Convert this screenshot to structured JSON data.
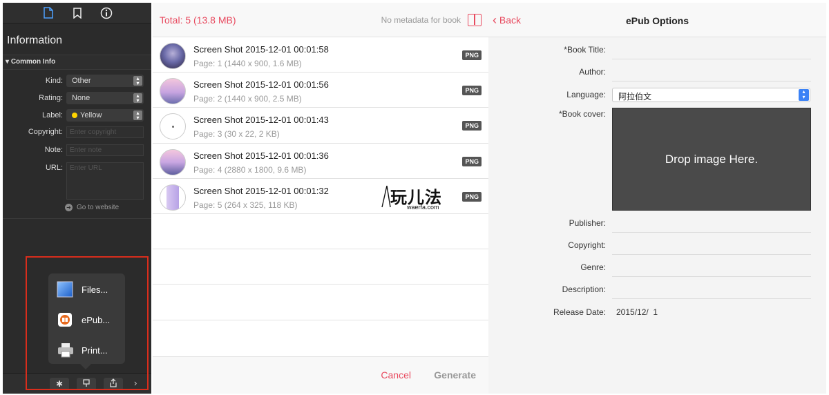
{
  "sidebar": {
    "title": "Information",
    "section": "Common Info",
    "fields": {
      "kind_label": "Kind:",
      "kind_value": "Other",
      "rating_label": "Rating:",
      "rating_value": "None",
      "label_label": "Label:",
      "label_value": "Yellow",
      "copyright_label": "Copyright:",
      "copyright_placeholder": "Enter copyright",
      "note_label": "Note:",
      "note_placeholder": "Enter note",
      "url_label": "URL:",
      "url_placeholder": "Enter URL"
    },
    "go_to_website": "Go to website",
    "popup": {
      "files": "Files...",
      "epub": "ePub...",
      "print": "Print..."
    }
  },
  "list": {
    "total": "Total: 5 (13.8 MB)",
    "no_metadata": "No metadata for book",
    "items": [
      {
        "name": "Screen Shot 2015-12-01 00:01:58",
        "sub": "Page: 1 (1440 x 900, 1.6 MB)",
        "badge": "PNG"
      },
      {
        "name": "Screen Shot 2015-12-01 00:01:56",
        "sub": "Page: 2 (1440 x 900, 2.5 MB)",
        "badge": "PNG"
      },
      {
        "name": "Screen Shot 2015-12-01 00:01:43",
        "sub": "Page: 3 (30 x 22, 2 KB)",
        "badge": "PNG"
      },
      {
        "name": "Screen Shot 2015-12-01 00:01:36",
        "sub": "Page: 4 (2880 x 1800, 9.6 MB)",
        "badge": "PNG"
      },
      {
        "name": "Screen Shot 2015-12-01 00:01:32",
        "sub": "Page: 5 (264 x 325, 118 KB)",
        "badge": "PNG"
      }
    ],
    "watermark_big": "玩儿法",
    "watermark_small": "waerfa.com",
    "cancel": "Cancel",
    "generate": "Generate"
  },
  "options": {
    "back": "Back",
    "title": "ePub Options",
    "book_title": "*Book Title:",
    "author": "Author:",
    "language": "Language:",
    "language_value": "阿拉伯文",
    "book_cover": "*Book cover:",
    "drop_image": "Drop image Here.",
    "publisher": "Publisher:",
    "copyright": "Copyright:",
    "genre": "Genre:",
    "description": "Description:",
    "release_date": "Release Date:",
    "release_date_value": "2015/12/  1"
  }
}
